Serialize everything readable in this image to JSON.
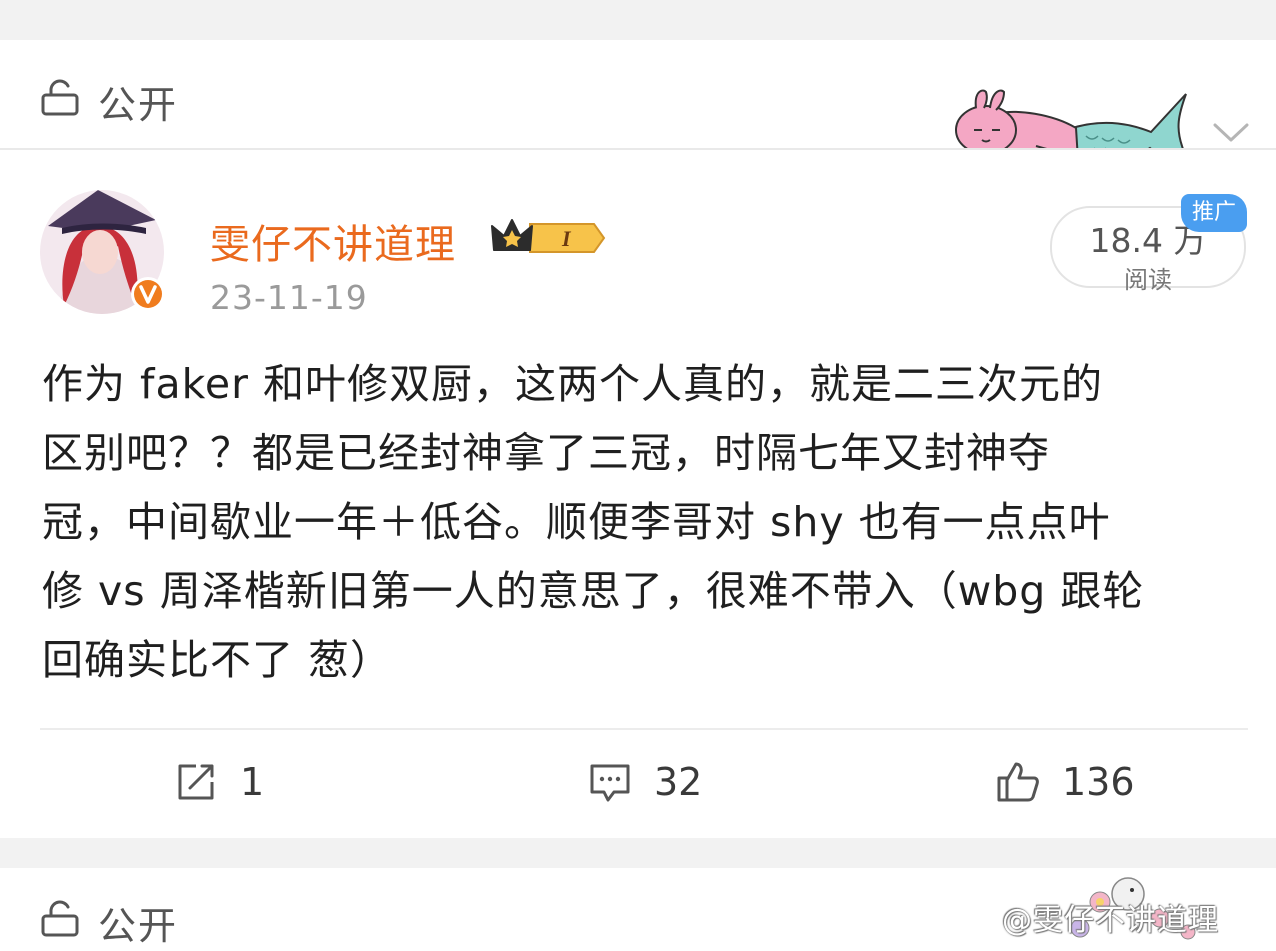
{
  "visibility": {
    "label": "公开"
  },
  "post": {
    "author": "雯仔不讲道理",
    "level_badge": "I",
    "date": "23-11-19",
    "views": {
      "count": "18.4 万",
      "label": "阅读"
    },
    "promo_badge": "推广",
    "body": "作为 faker 和叶修双厨，这两个人真的，就是二三次元的\n区别吧？？都是已经封神拿了三冠，时隔七年又封神夺\n冠，中间歇业一年＋低谷。顺便李哥对 shy 也有一点点叶\n修 vs 周泽楷新旧第一人的意思了，很难不带入（wbg 跟轮\n回确实比不了 葱）",
    "actions": {
      "repost_count": "1",
      "comment_count": "32",
      "like_count": "136"
    }
  },
  "next_post": {
    "visibility_label": "公开"
  },
  "watermark": "@雯仔不讲道理",
  "colors": {
    "username": "#ea6a1e",
    "promo_badge": "#4a9ef0",
    "background": "#f2f2f2"
  }
}
